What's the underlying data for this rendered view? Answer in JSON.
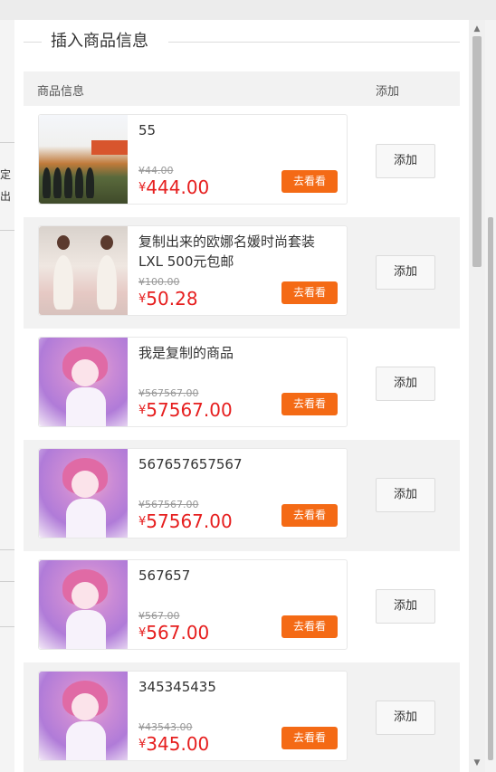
{
  "dialog": {
    "title": "插入商品信息",
    "header": {
      "info": "商品信息",
      "add": "添加"
    }
  },
  "background": {
    "frag1": "定",
    "frag2": "出"
  },
  "products": [
    {
      "name": "55",
      "old_price": "¥44.00",
      "currency": "¥",
      "price": "444.00",
      "look": "去看看",
      "add": "添加",
      "thumb": "crowd-photo"
    },
    {
      "name": "复制出来的欧娜名媛时尚套装LXL 500元包邮",
      "old_price": "¥100.00",
      "currency": "¥",
      "price": "50.28",
      "look": "去看看",
      "add": "添加",
      "thumb": "dress-photo"
    },
    {
      "name": "我是复制的商品",
      "old_price": "¥567567.00",
      "currency": "¥",
      "price": "57567.00",
      "look": "去看看",
      "add": "添加",
      "thumb": "anime-girl"
    },
    {
      "name": "567657657567",
      "old_price": "¥567567.00",
      "currency": "¥",
      "price": "57567.00",
      "look": "去看看",
      "add": "添加",
      "thumb": "anime-girl"
    },
    {
      "name": "567657",
      "old_price": "¥567.00",
      "currency": "¥",
      "price": "567.00",
      "look": "去看看",
      "add": "添加",
      "thumb": "anime-girl"
    },
    {
      "name": "345345435",
      "old_price": "¥43543.00",
      "currency": "¥",
      "price": "345.00",
      "look": "去看看",
      "add": "添加",
      "thumb": "anime-girl"
    }
  ],
  "icons": {
    "scroll_up": "arrow-up-icon",
    "scroll_down": "arrow-down-icon"
  },
  "colors": {
    "price": "#e61e1e",
    "look_button": "#f46a15",
    "row_alt": "#f2f2f2"
  }
}
